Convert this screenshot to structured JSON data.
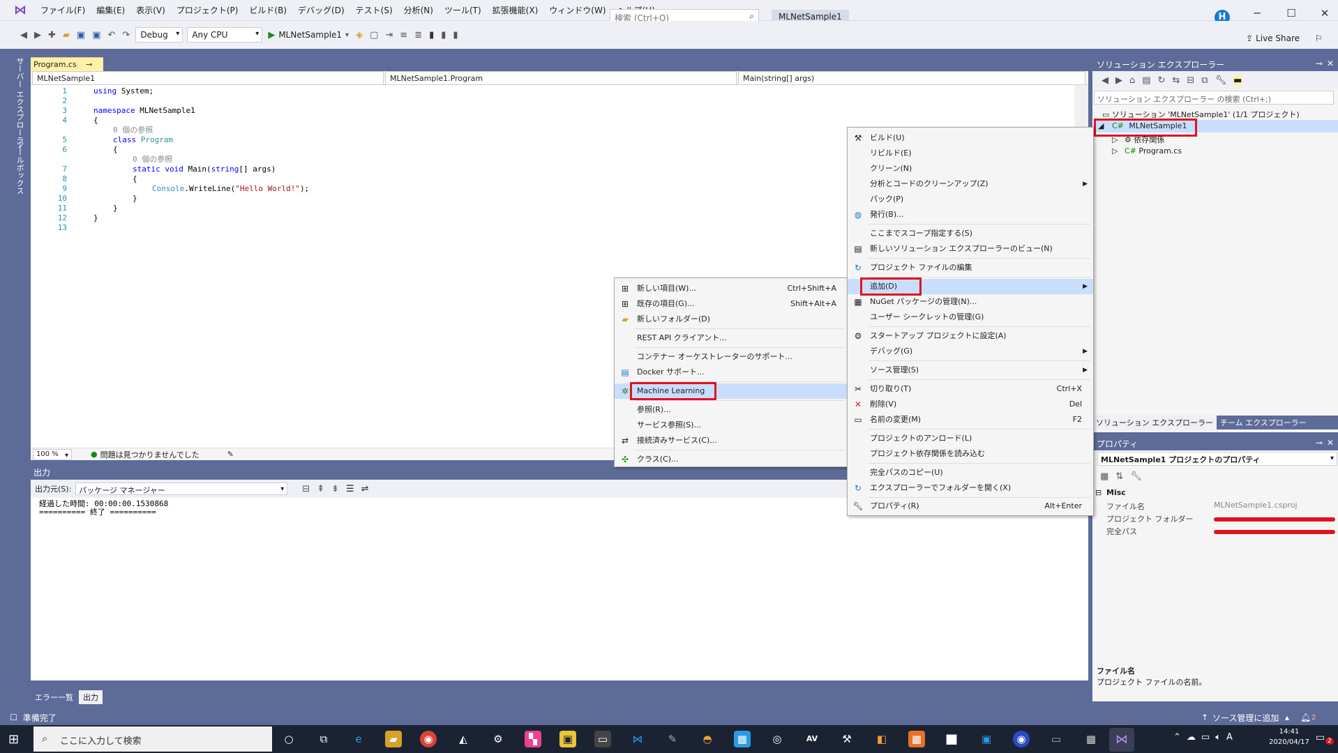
{
  "menu": {
    "items": [
      "ファイル(F)",
      "編集(E)",
      "表示(V)",
      "プロジェクト(P)",
      "ビルド(B)",
      "デバッグ(D)",
      "テスト(S)",
      "分析(N)",
      "ツール(T)",
      "拡張機能(X)",
      "ウィンドウ(W)",
      "ヘルプ(H)"
    ],
    "search_placeholder": "検索 (Ctrl+Q)",
    "project_title": "MLNetSample1",
    "avatar": "H"
  },
  "toolbar": {
    "config": "Debug",
    "platform": "Any CPU",
    "start": "MLNetSample1",
    "live_share": "Live Share"
  },
  "side_tabs": {
    "server_explorer": "サーバー エクスプローラー",
    "toolbox": "ツールボックス"
  },
  "editor": {
    "tab": "Program.cs",
    "nav_project": "MLNetSample1",
    "nav_class": "MLNetSample1.Program",
    "nav_member": "Main(string[] args)",
    "lines": [
      "1",
      "2",
      "3",
      "4",
      "5",
      "6",
      "7",
      "8",
      "9",
      "10",
      "11",
      "12",
      "13"
    ],
    "code": {
      "l1_kw": "using",
      "l1_rest": " System;",
      "l3_kw": "namespace",
      "l3_rest": " MLNetSample1",
      "l4": "{",
      "ref1": "0 個の参照",
      "l5_kw": "class",
      "l5_ty": " Program",
      "l6": "{",
      "ref2": "0 個の参照",
      "l7_kw": "static void",
      "l7_rest": " Main(",
      "l7_kw2": "string",
      "l7_rest2": "[] args)",
      "l8": "{",
      "l9_ty": "Console",
      "l9_rest": ".WriteLine(",
      "l9_st": "\"Hello World!\"",
      "l9_end": ");",
      "l10": "}",
      "l11": "}",
      "l12": "}"
    },
    "zoom": "100 %",
    "issues": "問題は見つかりませんでした"
  },
  "output": {
    "title": "出力",
    "source_label": "出力元(S):",
    "source_value": "パッケージ マネージャー",
    "line1": "経過した時間: 00:00:00.1530868",
    "line2": "========== 終了 ==========",
    "tabs": [
      "エラー一覧",
      "出力"
    ]
  },
  "status": {
    "ready": "準備完了",
    "source_control": "ソース管理に追加",
    "notifications": "2"
  },
  "solution_explorer": {
    "title": "ソリューション エクスプローラー",
    "search": "ソリューション エクスプローラー の検索 (Ctrl+;)",
    "solution": "ソリューション 'MLNetSample1' (1/1 プロジェクト)",
    "project": "MLNetSample1",
    "dependencies": "依存関係",
    "file": "Program.cs",
    "tab1": "ソリューション エクスプローラー",
    "tab2": "チーム エクスプローラー"
  },
  "properties": {
    "title": "プロパティ",
    "object": "MLNetSample1 プロジェクトのプロパティ",
    "category": "Misc",
    "rows": [
      {
        "k": "ファイル名",
        "v": "MLNetSample1.csproj"
      },
      {
        "k": "プロジェクト フォルダー",
        "v": ""
      },
      {
        "k": "完全パス",
        "v": ""
      }
    ],
    "desc_title": "ファイル名",
    "desc_text": "プロジェクト ファイルの名前。"
  },
  "context_menu": [
    {
      "label": "ビルド(U)",
      "icon": "build-icon"
    },
    {
      "label": "リビルド(E)"
    },
    {
      "label": "クリーン(N)"
    },
    {
      "label": "分析とコードのクリーンアップ(Z)",
      "submenu": true
    },
    {
      "label": "パック(P)"
    },
    {
      "label": "発行(B)...",
      "icon": "globe-icon"
    },
    {
      "label": "ここまでスコープ指定する(S)"
    },
    {
      "label": "新しいソリューション エクスプローラーのビュー(N)",
      "icon": "view-icon"
    },
    {
      "label": "プロジェクト ファイルの編集",
      "icon": "refresh-icon"
    },
    {
      "label": "追加(D)",
      "submenu": true
    },
    {
      "label": "NuGet パッケージの管理(N)...",
      "icon": "package-icon"
    },
    {
      "label": "ユーザー シークレットの管理(G)"
    },
    {
      "label": "スタートアップ プロジェクトに設定(A)",
      "icon": "gear-icon"
    },
    {
      "label": "デバッグ(G)",
      "submenu": true
    },
    {
      "label": "ソース管理(S)",
      "submenu": true
    },
    {
      "label": "切り取り(T)",
      "shortcut": "Ctrl+X",
      "icon": "cut-icon"
    },
    {
      "label": "削除(V)",
      "shortcut": "Del",
      "icon": "delete-icon"
    },
    {
      "label": "名前の変更(M)",
      "shortcut": "F2",
      "icon": "rename-icon"
    },
    {
      "label": "プロジェクトのアンロード(L)"
    },
    {
      "label": "プロジェクト依存関係を読み込む"
    },
    {
      "label": "完全パスのコピー(U)"
    },
    {
      "label": "エクスプローラーでフォルダーを開く(X)",
      "icon": "refresh-icon"
    },
    {
      "label": "プロパティ(R)",
      "shortcut": "Alt+Enter",
      "icon": "wrench-icon"
    }
  ],
  "add_submenu": [
    {
      "label": "新しい項目(W)...",
      "shortcut": "Ctrl+Shift+A"
    },
    {
      "label": "既存の項目(G)...",
      "shortcut": "Shift+Alt+A"
    },
    {
      "label": "新しいフォルダー(D)"
    },
    {
      "label": "REST API クライアント..."
    },
    {
      "label": "コンテナー オーケストレーターのサポート..."
    },
    {
      "label": "Docker サポート..."
    },
    {
      "label": "Machine Learning"
    },
    {
      "label": "参照(R)..."
    },
    {
      "label": "サービス参照(S)..."
    },
    {
      "label": "接続済みサービス(C)..."
    },
    {
      "label": "クラス(C)..."
    }
  ],
  "taskbar": {
    "search": "ここに入力して検索",
    "time": "14:41",
    "date": "2020/04/17",
    "ime": "A",
    "badge": "2"
  }
}
